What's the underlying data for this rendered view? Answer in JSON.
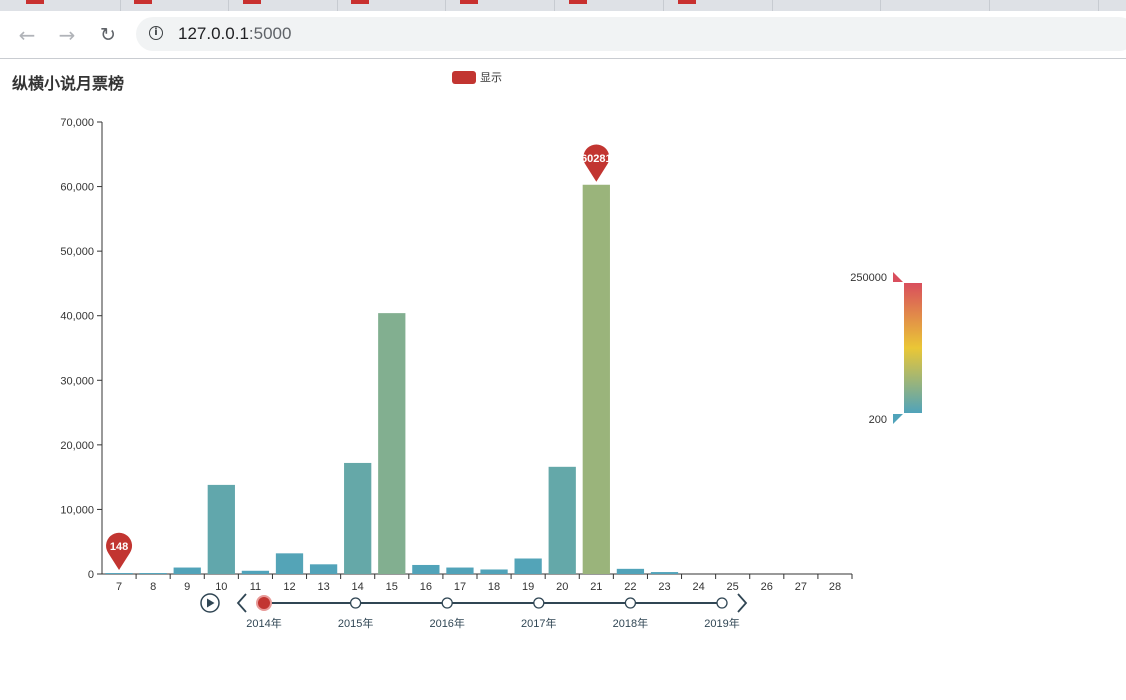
{
  "browser": {
    "url_host": "127.0.0.1",
    "url_port": ":5000",
    "back_icon": "arrow-left-icon",
    "forward_icon": "arrow-right-icon",
    "reload_icon": "reload-icon",
    "site_info_icon": "info-icon"
  },
  "chart_data": {
    "type": "bar",
    "title": "纵横小说月票榜",
    "legend": {
      "label": "显示",
      "color": "#c23531",
      "placement": "top-center"
    },
    "categories": [
      "7",
      "8",
      "9",
      "10",
      "11",
      "12",
      "13",
      "14",
      "15",
      "16",
      "17",
      "18",
      "19",
      "20",
      "21",
      "22",
      "23",
      "24",
      "25",
      "26",
      "27",
      "28"
    ],
    "values": [
      148,
      150,
      1000,
      13800,
      500,
      3200,
      1500,
      17200,
      40400,
      1400,
      1000,
      700,
      2400,
      16600,
      60281,
      800,
      300,
      0,
      0,
      0,
      0,
      0
    ],
    "ylim": [
      0,
      70000
    ],
    "yticks": [
      "0",
      "10,000",
      "20,000",
      "30,000",
      "40,000",
      "50,000",
      "60,000",
      "70,000"
    ],
    "ytick_values": [
      0,
      10000,
      20000,
      30000,
      40000,
      50000,
      60000,
      70000
    ],
    "mark_points": [
      {
        "type": "min",
        "category": "7",
        "label": "148"
      },
      {
        "type": "max",
        "category": "21",
        "label": "60281"
      }
    ],
    "visual_map": {
      "min": 200,
      "max": 250000,
      "min_label": "200",
      "max_label": "250000",
      "colors": [
        "#50a3ba",
        "#eac736",
        "#d94e5d"
      ]
    },
    "timeline": {
      "labels": [
        "2014年",
        "2015年",
        "2016年",
        "2017年",
        "2018年",
        "2019年"
      ],
      "current": 0,
      "play_icon": "play-icon",
      "prev_icon": "chevron-left-icon",
      "next_icon": "chevron-right-icon"
    }
  }
}
